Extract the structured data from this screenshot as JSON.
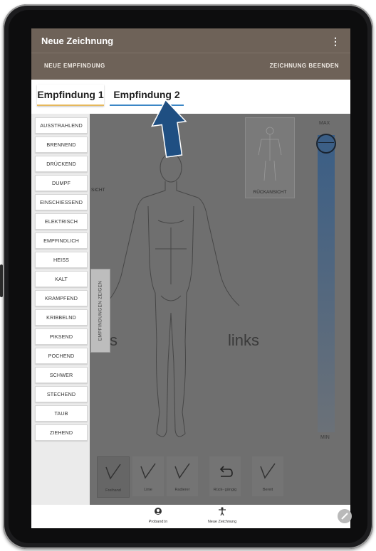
{
  "app": {
    "title": "Neue Zeichnung",
    "overflow_icon": "⋮"
  },
  "actions": {
    "new_sensation": "NEUE EMPFINDUNG",
    "end_drawing": "ZEICHNUNG BEENDEN"
  },
  "tabs": [
    {
      "label": "Empfindung 1",
      "underline_color": "#e6b85c"
    },
    {
      "label": "Empfindung 2",
      "underline_color": "#3b86c6",
      "selected": true
    }
  ],
  "sensations": [
    "AUSSTRAHLEND",
    "BRENNEND",
    "DRÜCKEND",
    "DUMPF",
    "EINSCHIESSEND",
    "ELEKTRISCH",
    "EMPFINDLICH",
    "HEISS",
    "KALT",
    "KRAMPFEND",
    "KRIBBELND",
    "PIKSEND",
    "POCHEND",
    "SCHWER",
    "STECHEND",
    "TAUB",
    "ZIEHEND"
  ],
  "side_tab_label": "EMPFINDUNGEN ZEIGEN",
  "views": {
    "front_partial": "SICHT",
    "back": "RÜCKANSICHT"
  },
  "body_sides": {
    "left_partial": "s",
    "right": "links"
  },
  "scale": {
    "max_label": "MAX",
    "min_label": "MIN",
    "level": 1.0,
    "colors": {
      "top": "#3a5e86",
      "bottom": "#6b7178"
    }
  },
  "tools": [
    {
      "label": "Freihand",
      "icon": "pen-icon",
      "active": true
    },
    {
      "label": "Linie",
      "icon": "line-pen-icon"
    },
    {
      "label": "Radierer",
      "icon": "eraser-icon"
    },
    {
      "label": "Rück-\ngängig",
      "icon": "undo-icon"
    },
    {
      "label": "Bereit",
      "icon": "pen-check-icon"
    }
  ],
  "bottom_nav": [
    {
      "label": "Proband:in",
      "icon": "account-icon"
    },
    {
      "label": "Neue Zeichnung",
      "icon": "person-icon"
    }
  ],
  "colors": {
    "appbar": "#6e6258",
    "arrow": "#1f4f82"
  }
}
